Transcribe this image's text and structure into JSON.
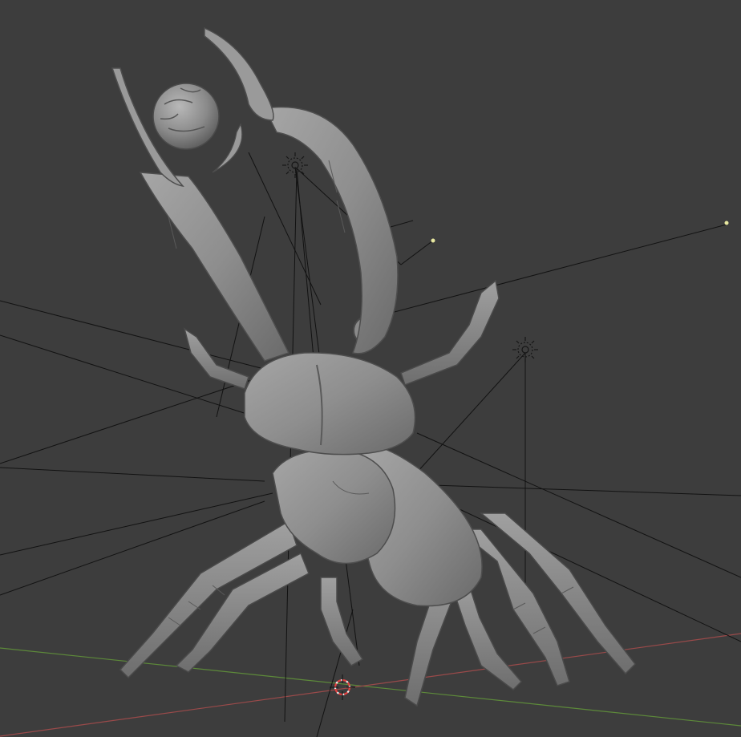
{
  "viewport": {
    "background": "#3d3d3d",
    "grid_x_axis_color": "#9a4a4a",
    "grid_y_axis_color": "#5d8a3a",
    "mesh_color": "#8c8c8c",
    "mesh_dark": "#5e5e5e",
    "mesh_light": "#b4b4b4",
    "guide_line_color": "#121212"
  },
  "objects": {
    "model_icon": "stag-beetle-mesh",
    "sphere_icon": "textured-sphere",
    "light_icon": "sun-lamp-icon",
    "cursor_icon": "3d-cursor-icon"
  }
}
